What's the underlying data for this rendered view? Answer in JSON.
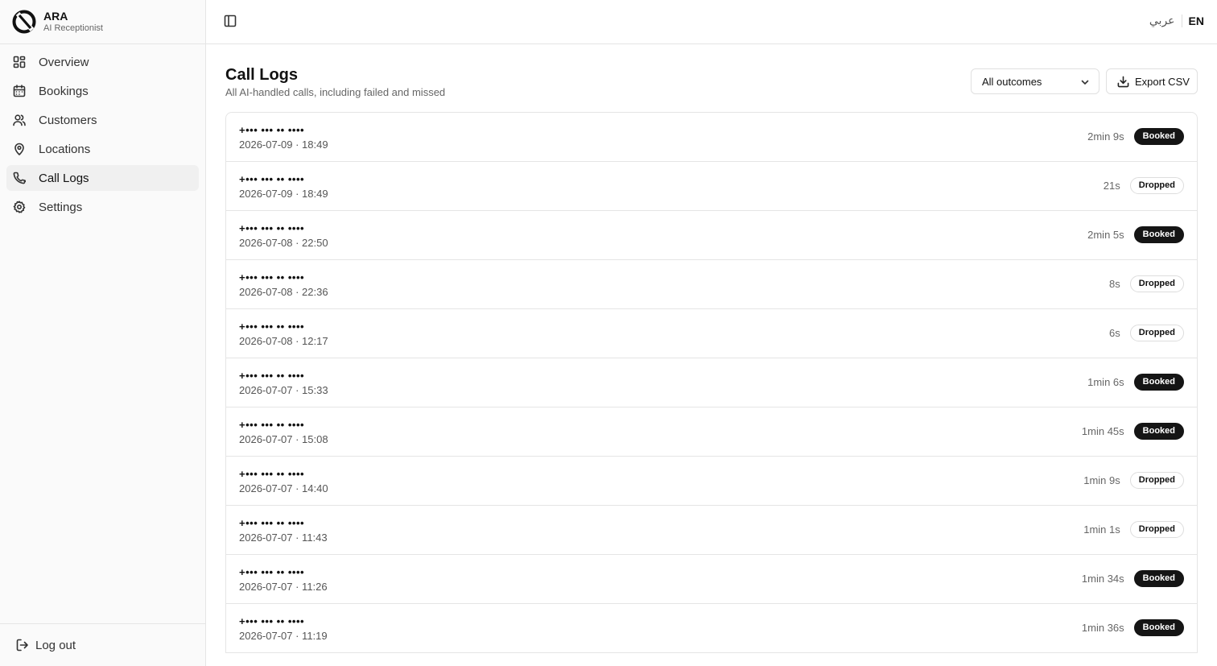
{
  "brand": {
    "name": "ARA",
    "subtitle": "AI Receptionist"
  },
  "nav": {
    "items": [
      {
        "label": "Overview",
        "icon": "layout-grid-icon"
      },
      {
        "label": "Bookings",
        "icon": "calendar-icon"
      },
      {
        "label": "Customers",
        "icon": "users-icon"
      },
      {
        "label": "Locations",
        "icon": "map-pin-icon"
      },
      {
        "label": "Call Logs",
        "icon": "phone-icon",
        "active": true
      },
      {
        "label": "Settings",
        "icon": "gear-icon"
      }
    ],
    "logout_label": "Log out"
  },
  "topbar": {
    "lang_ar": "عربي",
    "lang_en": "EN"
  },
  "page": {
    "title": "Call Logs",
    "subtitle": "All AI-handled calls, including failed and missed"
  },
  "filter": {
    "selected": "All outcomes"
  },
  "export_label": "Export CSV",
  "calls": [
    {
      "phone": "+••• ••• •• ••••",
      "datetime": "2026-07-09 · 18:49",
      "duration": "2min 9s",
      "outcome": "Booked"
    },
    {
      "phone": "+••• ••• •• ••••",
      "datetime": "2026-07-09 · 18:49",
      "duration": "21s",
      "outcome": "Dropped"
    },
    {
      "phone": "+••• ••• •• ••••",
      "datetime": "2026-07-08 · 22:50",
      "duration": "2min 5s",
      "outcome": "Booked"
    },
    {
      "phone": "+••• ••• •• ••••",
      "datetime": "2026-07-08 · 22:36",
      "duration": "8s",
      "outcome": "Dropped"
    },
    {
      "phone": "+••• ••• •• ••••",
      "datetime": "2026-07-08 · 12:17",
      "duration": "6s",
      "outcome": "Dropped"
    },
    {
      "phone": "+••• ••• •• ••••",
      "datetime": "2026-07-07 · 15:33",
      "duration": "1min 6s",
      "outcome": "Booked"
    },
    {
      "phone": "+••• ••• •• ••••",
      "datetime": "2026-07-07 · 15:08",
      "duration": "1min 45s",
      "outcome": "Booked"
    },
    {
      "phone": "+••• ••• •• ••••",
      "datetime": "2026-07-07 · 14:40",
      "duration": "1min 9s",
      "outcome": "Dropped"
    },
    {
      "phone": "+••• ••• •• ••••",
      "datetime": "2026-07-07 · 11:43",
      "duration": "1min 1s",
      "outcome": "Dropped"
    },
    {
      "phone": "+••• ••• •• ••••",
      "datetime": "2026-07-07 · 11:26",
      "duration": "1min 34s",
      "outcome": "Booked"
    },
    {
      "phone": "+••• ••• •• ••••",
      "datetime": "2026-07-07 · 11:19",
      "duration": "1min 36s",
      "outcome": "Booked"
    }
  ]
}
